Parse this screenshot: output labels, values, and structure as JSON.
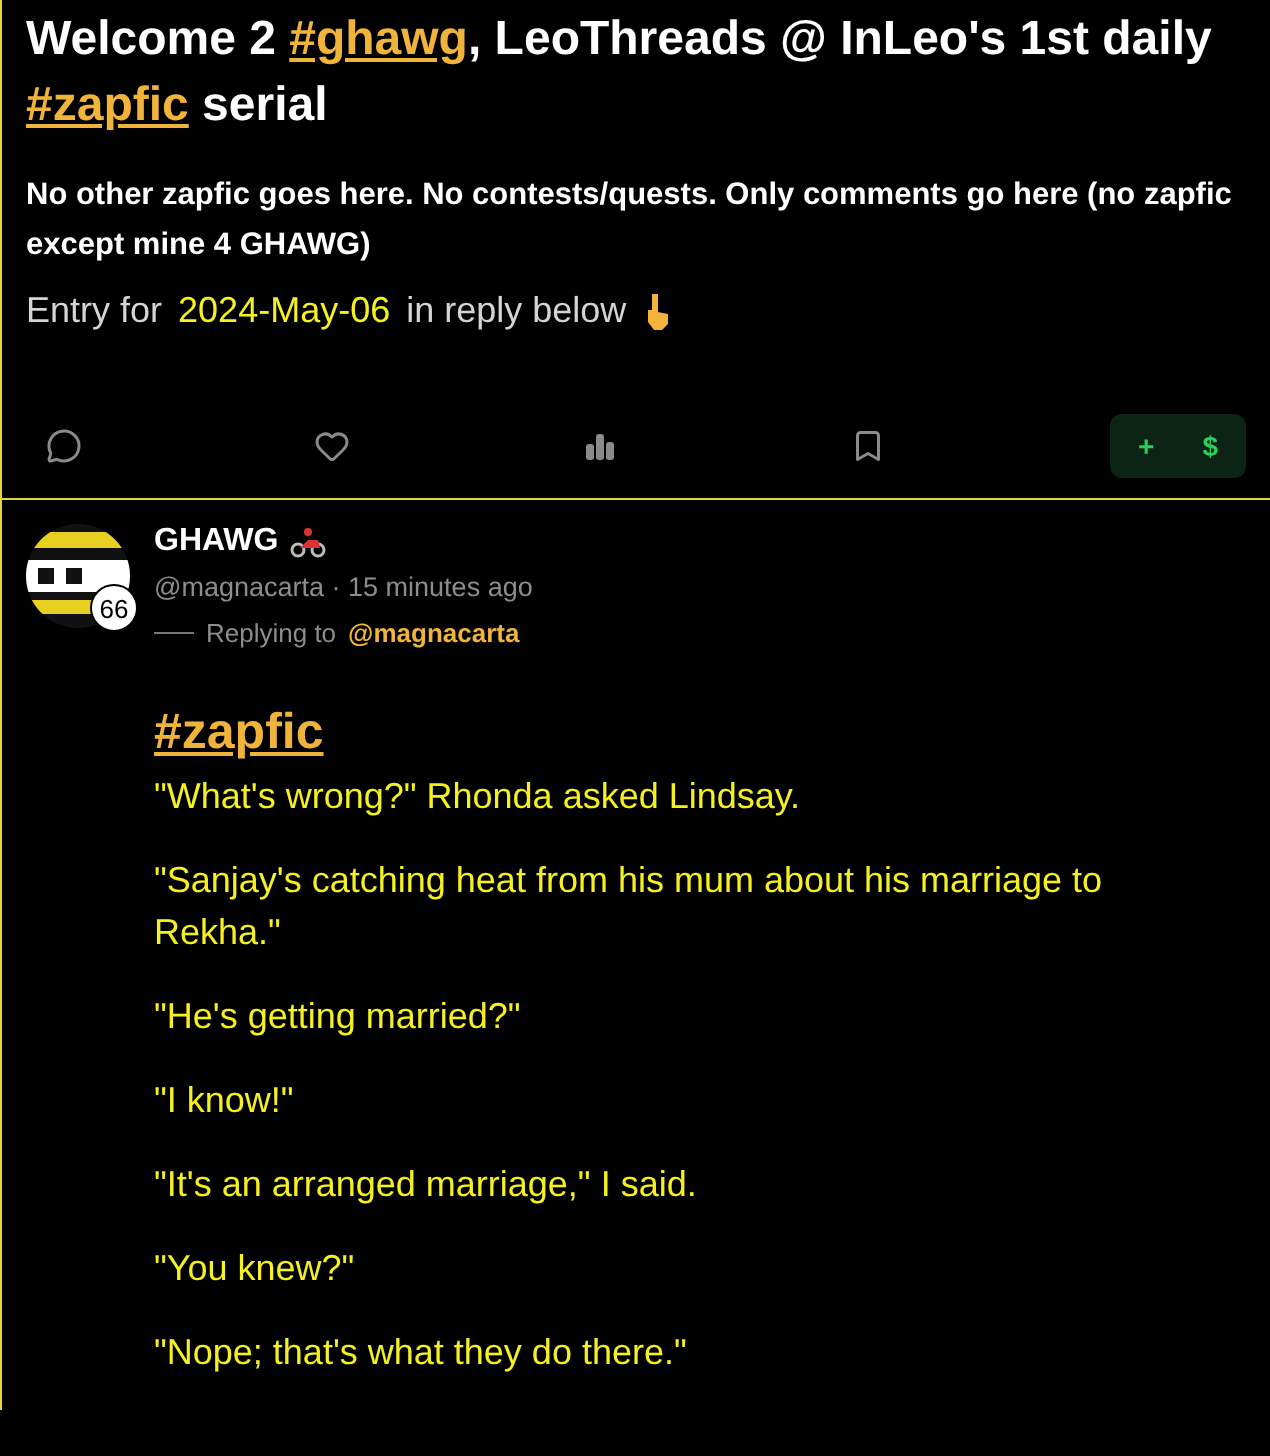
{
  "post": {
    "title_parts": [
      {
        "text": "Welcome 2 ",
        "link": false
      },
      {
        "text": "#ghawg",
        "link": true
      },
      {
        "text": ", LeoThreads @ InLeo's 1st daily ",
        "link": false
      },
      {
        "text": "#zapfic",
        "link": true
      },
      {
        "text": " serial",
        "link": false
      }
    ],
    "notice": "No other zapfic goes here. No contests/quests. Only comments go here (no zapfic except mine 4 GHAWG)",
    "entry": {
      "before": "Entry for",
      "date": "2024-May-06",
      "after": "in reply below"
    },
    "actions": {
      "tip_plus": "+",
      "tip_dollar": "$"
    }
  },
  "reply": {
    "author": "GHAWG",
    "badge": "66",
    "handle": "@magnacarta",
    "separator": "·",
    "time": "15 minutes ago",
    "replying_label": "Replying to",
    "replying_to": "@magnacarta",
    "tag": "#zapfic",
    "paragraphs": [
      "\"What's wrong?\" Rhonda asked Lindsay.",
      "\"Sanjay's catching heat from his mum about his marriage to Rekha.\"",
      "\"He's getting married?\"",
      "\"I know!\"",
      "\"It's an arranged marriage,\" I said.",
      "\"You knew?\"",
      "\"Nope; that's what they do there.\""
    ]
  }
}
